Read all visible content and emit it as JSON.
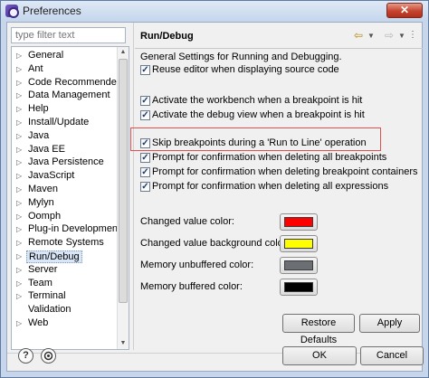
{
  "window": {
    "title": "Preferences",
    "close_label": "✕"
  },
  "filter": {
    "placeholder": "type filter text"
  },
  "tree": {
    "items": [
      {
        "label": "General",
        "expandable": true
      },
      {
        "label": "Ant",
        "expandable": true
      },
      {
        "label": "Code Recommenders",
        "expandable": true
      },
      {
        "label": "Data Management",
        "expandable": true
      },
      {
        "label": "Help",
        "expandable": true
      },
      {
        "label": "Install/Update",
        "expandable": true
      },
      {
        "label": "Java",
        "expandable": true
      },
      {
        "label": "Java EE",
        "expandable": true
      },
      {
        "label": "Java Persistence",
        "expandable": true
      },
      {
        "label": "JavaScript",
        "expandable": true
      },
      {
        "label": "Maven",
        "expandable": true
      },
      {
        "label": "Mylyn",
        "expandable": true
      },
      {
        "label": "Oomph",
        "expandable": true
      },
      {
        "label": "Plug-in Development",
        "expandable": true
      },
      {
        "label": "Remote Systems",
        "expandable": true
      },
      {
        "label": "Run/Debug",
        "expandable": true,
        "selected": true
      },
      {
        "label": "Server",
        "expandable": true
      },
      {
        "label": "Team",
        "expandable": true
      },
      {
        "label": "Terminal",
        "expandable": true
      },
      {
        "label": "Validation",
        "expandable": false
      },
      {
        "label": "Web",
        "expandable": true
      }
    ]
  },
  "page": {
    "title": "Run/Debug",
    "description": "General Settings for Running and Debugging.",
    "checkboxes": [
      {
        "label": "Reuse editor when displaying source code",
        "checked": true
      },
      {
        "label": "Activate the workbench when a breakpoint is hit",
        "checked": true
      },
      {
        "label": "Activate the debug view when a breakpoint is hit",
        "checked": true
      },
      {
        "label": "Skip breakpoints during a 'Run to Line' operation",
        "checked": true
      },
      {
        "label": "Prompt for confirmation when deleting all breakpoints",
        "checked": true
      },
      {
        "label": "Prompt for confirmation when deleting breakpoint containers",
        "checked": true
      },
      {
        "label": "Prompt for confirmation when deleting all expressions",
        "checked": true
      }
    ],
    "colors": [
      {
        "label": "Changed value color:",
        "color": "#ff0000"
      },
      {
        "label": "Changed value background color:",
        "color": "#ffff00"
      },
      {
        "label": "Memory unbuffered color:",
        "color": "#6b6e73"
      },
      {
        "label": "Memory buffered color:",
        "color": "#000000"
      }
    ],
    "restore_defaults_label": "Restore Defaults",
    "apply_label": "Apply"
  },
  "footer": {
    "help_icon_label": "?",
    "ok_label": "OK",
    "cancel_label": "Cancel"
  },
  "icons": [
    "back-arrow-icon",
    "forward-arrow-icon",
    "chevron-down-icon",
    "help-icon",
    "import-export-icon"
  ]
}
